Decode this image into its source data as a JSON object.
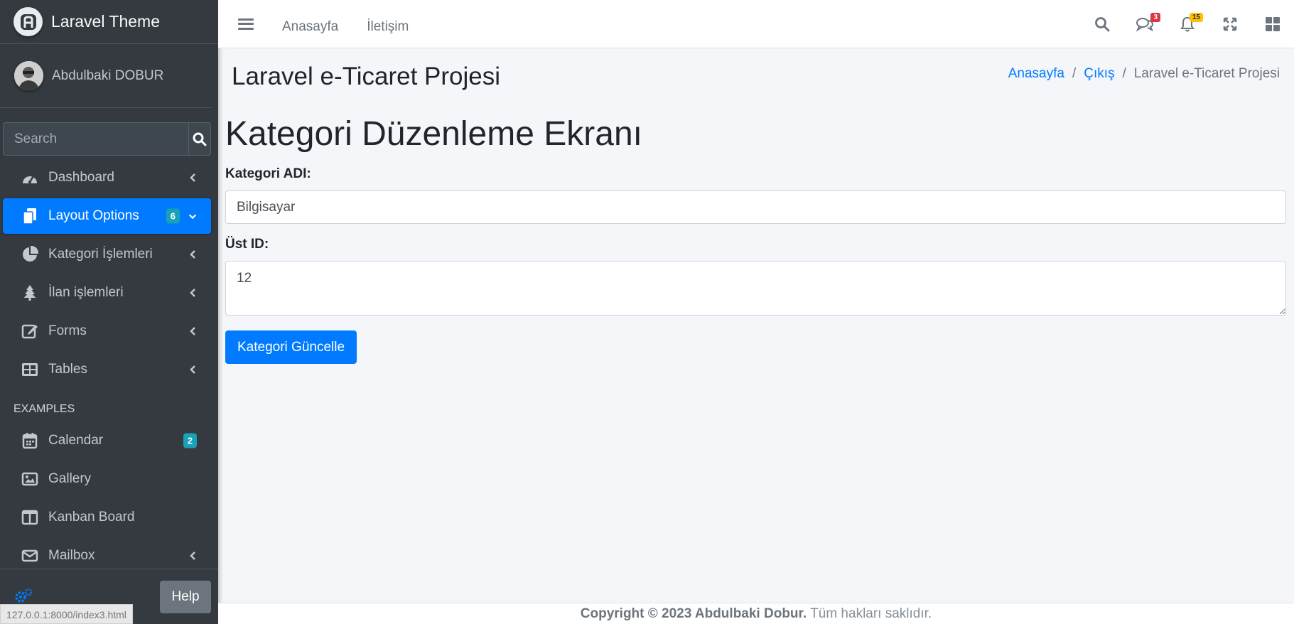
{
  "brand": {
    "title": "Laravel Theme"
  },
  "user": {
    "name": "Abdulbaki DOBUR"
  },
  "sidebar": {
    "search_placeholder": "Search",
    "items": [
      {
        "label": "Dashboard",
        "icon": "tachometer-icon"
      },
      {
        "label": "Layout Options",
        "icon": "copy-icon",
        "badge": "6",
        "active": true
      },
      {
        "label": "Kategori İşlemleri",
        "icon": "pie-chart-icon"
      },
      {
        "label": "İlan işlemleri",
        "icon": "tree-icon"
      },
      {
        "label": "Forms",
        "icon": "edit-icon"
      },
      {
        "label": "Tables",
        "icon": "table-icon"
      }
    ],
    "header": "EXAMPLES",
    "examples": [
      {
        "label": "Calendar",
        "icon": "calendar-icon",
        "badge": "2"
      },
      {
        "label": "Gallery",
        "icon": "image-icon"
      },
      {
        "label": "Kanban Board",
        "icon": "columns-icon"
      },
      {
        "label": "Mailbox",
        "icon": "envelope-icon"
      }
    ],
    "help_label": "Help",
    "status_url": "127.0.0.1:8000/index3.html"
  },
  "topbar": {
    "links": [
      "Anasayfa",
      "İletişim"
    ],
    "messages_count": "3",
    "notifications_count": "15"
  },
  "header": {
    "title": "Laravel e-Ticaret Projesi",
    "breadcrumb": [
      "Anasayfa",
      "Çıkış",
      "Laravel e-Ticaret Projesi"
    ]
  },
  "form": {
    "title": "Kategori Düzenleme Ekranı",
    "name_label": "Kategori ADI:",
    "name_value": "Bilgisayar",
    "parent_label": "Üst ID:",
    "parent_value": "12",
    "submit_label": "Kategori Güncelle"
  },
  "footer": {
    "copyright": "Copyright © 2023 Abdulbaki Dobur.",
    "rights": "Tüm hakları saklıdır."
  },
  "colors": {
    "sidebar_bg": "#343a40",
    "primary": "#007bff",
    "info_badge": "#17a2b8",
    "danger_badge": "#dc3545",
    "warning_badge": "#ffc107",
    "content_bg": "#f4f6f9"
  }
}
